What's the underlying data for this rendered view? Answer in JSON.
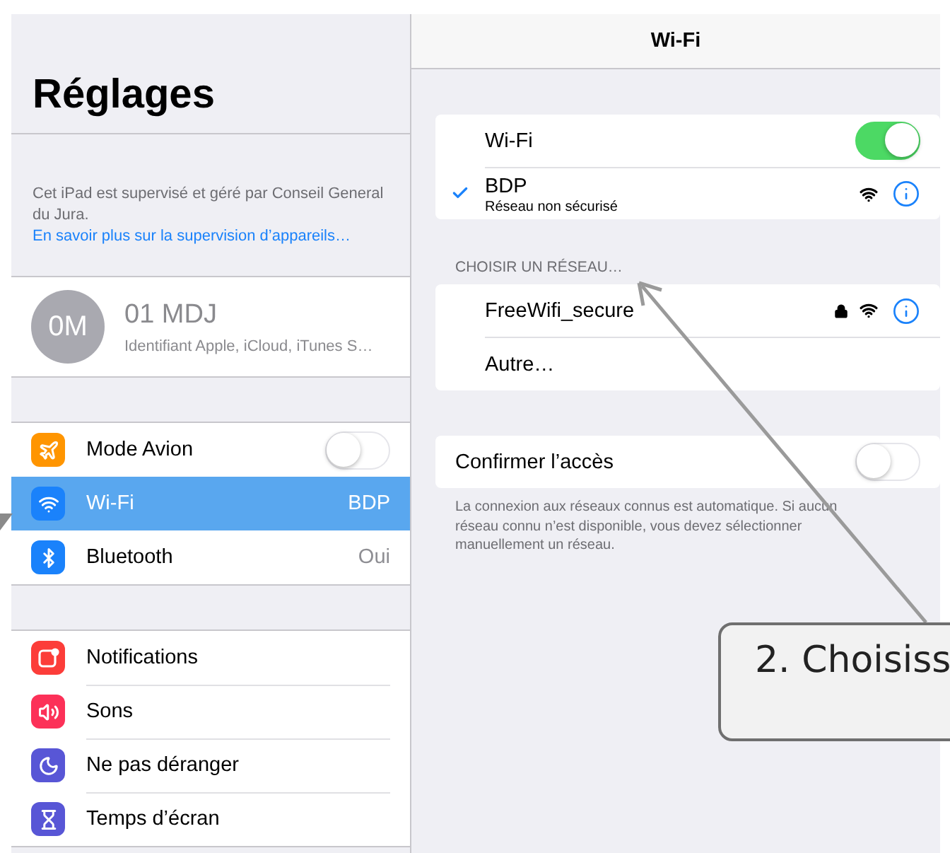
{
  "sidebar": {
    "title": "Réglages",
    "supervision": {
      "text": "Cet iPad est supervisé et géré par Conseil General du Jura.",
      "link": "En savoir plus sur la supervision d’appareils…"
    },
    "account": {
      "initials": "0M",
      "name": "01 MDJ",
      "subtitle": "Identifiant Apple, iCloud, iTunes S…"
    },
    "groups": [
      [
        {
          "kind": "toggle",
          "color": "#ff9500",
          "label": "Mode Avion",
          "on": false,
          "selected": false
        },
        {
          "kind": "value",
          "color": "#1a82fb",
          "label": "Wi-Fi",
          "value": "BDP",
          "selected": true
        },
        {
          "kind": "value",
          "color": "#1a82fb",
          "label": "Bluetooth",
          "value": "Oui",
          "selected": false
        }
      ],
      [
        {
          "kind": "plain",
          "color": "#fc3d39",
          "label": "Notifications",
          "selected": false
        },
        {
          "kind": "plain",
          "color": "#fc3158",
          "label": "Sons",
          "selected": false
        },
        {
          "kind": "plain",
          "color": "#5856d6",
          "label": "Ne pas déranger",
          "selected": false
        },
        {
          "kind": "plain",
          "color": "#5856d6",
          "label": "Temps d’écran",
          "selected": false
        }
      ]
    ]
  },
  "detail": {
    "title": "Wi-Fi",
    "wifi": {
      "label": "Wi-Fi",
      "on": true
    },
    "current": {
      "name": "BDP",
      "subtitle": "Réseau non sécurisé",
      "checked": true
    },
    "section_header": "CHOISIR UN RÉSEAU…",
    "networks": [
      {
        "kind": "network",
        "name": "FreeWifi_secure",
        "locked": true
      },
      {
        "kind": "other",
        "name": "Autre…"
      }
    ],
    "ask_join": {
      "label": "Confirmer l’accès",
      "on": false
    },
    "footnote": "La connexion aux réseaux connus est automatique. Si aucun réseau connu n’est disponible, vous devez sélectionner manuellement un réseau."
  },
  "callout": {
    "text": "2. Choisiss"
  }
}
